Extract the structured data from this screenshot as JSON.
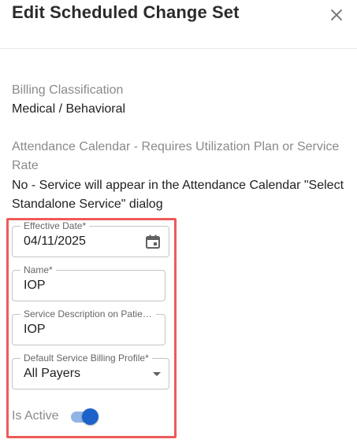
{
  "dialog": {
    "title": "Edit Scheduled Change Set",
    "close_icon": "close-icon"
  },
  "billing_classification": {
    "label": "Billing Classification",
    "value": "Medical / Behavioral"
  },
  "attendance_calendar": {
    "label_line1": "Attendance Calendar - Requires Utilization Plan or Service",
    "label_line2": "Rate",
    "value_line1": "No - Service will appear in the Attendance Calendar \"Select",
    "value_line2": "Standalone Service\" dialog"
  },
  "form": {
    "effective_date": {
      "label": "Effective Date*",
      "value": "04/11/2025",
      "icon": "calendar-icon"
    },
    "name": {
      "label": "Name*",
      "value": "IOP"
    },
    "service_description": {
      "label": "Service Description on Patien...",
      "value": "IOP"
    },
    "billing_profile": {
      "label": "Default Service Billing Profile*",
      "value": "All Payers",
      "icon": "dropdown-caret-icon"
    },
    "is_active": {
      "label": "Is Active",
      "checked": true
    }
  },
  "colors": {
    "highlight_border": "#ee5a5a",
    "toggle_track": "#90b4e6",
    "toggle_thumb": "#1c62c8"
  }
}
